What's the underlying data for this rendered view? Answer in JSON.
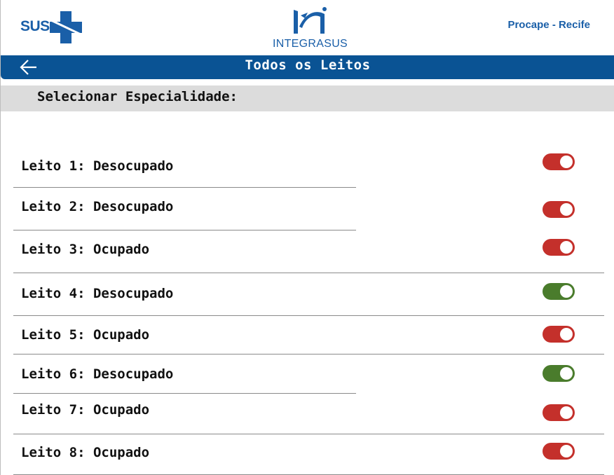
{
  "header": {
    "sus_text": "SUS",
    "integrasus_text": "INTEGRASUS",
    "location": "Procape - Recife"
  },
  "titlebar": {
    "title": "Todos os Leitos"
  },
  "specialty": {
    "label": "Selecionar Especialidade:"
  },
  "colors": {
    "brand_blue": "#0a5394",
    "toggle_red": "#c4302b",
    "toggle_green": "#4a7c2c"
  },
  "beds": [
    {
      "label": "Leito 1: Desocupado",
      "toggle_color": "#c4302b"
    },
    {
      "label": "Leito 2: Desocupado",
      "toggle_color": "#c4302b"
    },
    {
      "label": "Leito 3: Ocupado",
      "toggle_color": "#c4302b"
    },
    {
      "label": "Leito 4: Desocupado",
      "toggle_color": "#4a7c2c"
    },
    {
      "label": "Leito 5: Ocupado",
      "toggle_color": "#c4302b"
    },
    {
      "label": "Leito 6: Desocupado",
      "toggle_color": "#4a7c2c"
    },
    {
      "label": "Leito 7: Ocupado",
      "toggle_color": "#c4302b"
    },
    {
      "label": "Leito 8: Ocupado",
      "toggle_color": "#c4302b"
    }
  ]
}
